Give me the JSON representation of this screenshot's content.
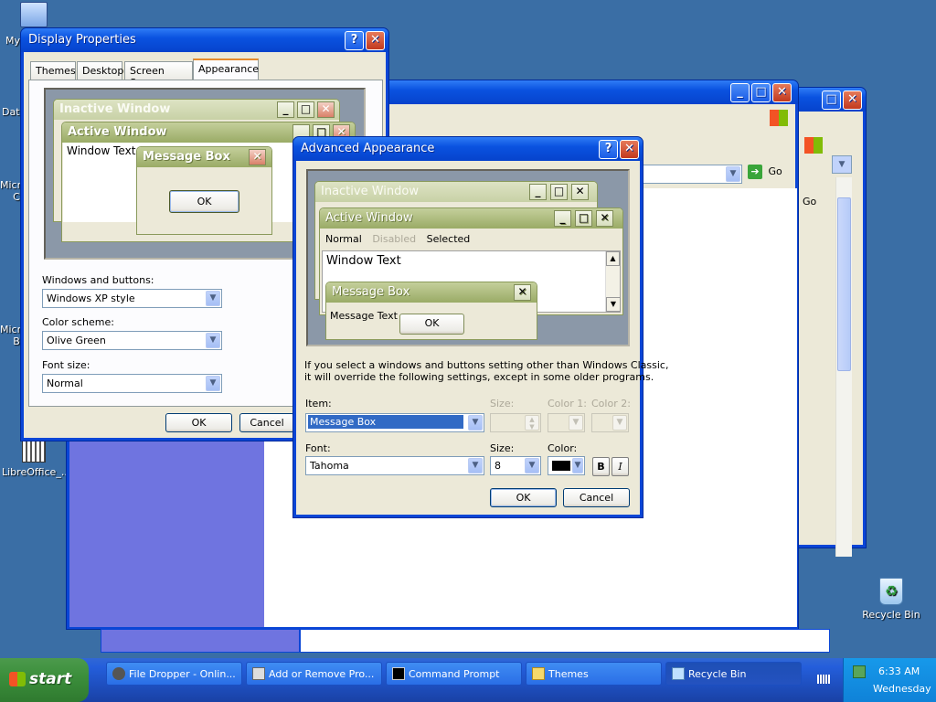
{
  "desktop_icons": {
    "my": "My",
    "data": "Data",
    "micro1a": "Micro",
    "micro1b": "C",
    "micro2a": "Micro",
    "micro2b": "B",
    "libreoffice": "LibreOffice_...",
    "recycle": "Recycle Bin"
  },
  "bg_window": {
    "go_label": "Go",
    "go_label2": "Go"
  },
  "display_properties": {
    "title": "Display Properties",
    "help": "?",
    "close": "✕",
    "tabs": [
      "Themes",
      "Desktop",
      "Screen Saver",
      "Appearance"
    ],
    "preview": {
      "inactive_title": "Inactive Window",
      "active_title": "Active Window",
      "window_text": "Window Text",
      "message_box_title": "Message Box",
      "ok": "OK"
    },
    "windows_buttons_label": "Windows and buttons:",
    "windows_buttons_value": "Windows XP style",
    "color_scheme_label": "Color scheme:",
    "color_scheme_value": "Olive Green",
    "font_size_label": "Font size:",
    "font_size_value": "Normal",
    "ok": "OK",
    "cancel": "Cancel"
  },
  "advanced_appearance": {
    "title": "Advanced Appearance",
    "help": "?",
    "close": "✕",
    "preview": {
      "inactive_title": "Inactive Window",
      "active_title": "Active Window",
      "menu_normal": "Normal",
      "menu_disabled": "Disabled",
      "menu_selected": "Selected",
      "window_text": "Window Text",
      "message_box_title": "Message Box",
      "message_text": "Message Text",
      "ok": "OK"
    },
    "info_line1": "If you select a windows and buttons setting other than Windows Classic,",
    "info_line2": "it will override the following settings, except in some older programs.",
    "item_label": "Item:",
    "item_value": "Message Box",
    "size_label": "Size:",
    "color1_label": "Color 1:",
    "color2_label": "Color 2:",
    "font_label": "Font:",
    "font_value": "Tahoma",
    "font_size_label": "Size:",
    "font_size_value": "8",
    "color_label": "Color:",
    "color_value": "#000000",
    "bold": "B",
    "italic": "I",
    "ok": "OK",
    "cancel": "Cancel"
  },
  "taskbar": {
    "start": "start",
    "tasks": [
      "File Dropper - Onlin...",
      "Add or Remove Pro...",
      "Command Prompt",
      "Themes",
      "Recycle Bin"
    ],
    "time": "6:33 AM",
    "day": "Wednesday"
  }
}
